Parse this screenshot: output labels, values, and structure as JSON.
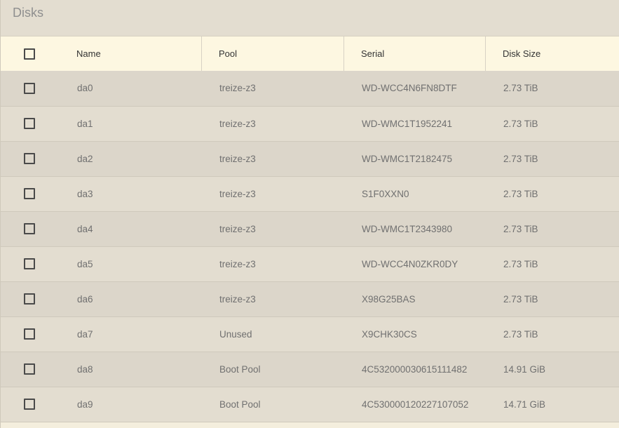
{
  "panel": {
    "title": "Disks"
  },
  "table": {
    "columns": [
      "Name",
      "Pool",
      "Serial",
      "Disk Size"
    ],
    "rows": [
      {
        "name": "da0",
        "pool": "treize-z3",
        "serial": "WD-WCC4N6FN8DTF",
        "size": "2.73 TiB"
      },
      {
        "name": "da1",
        "pool": "treize-z3",
        "serial": "WD-WMC1T1952241",
        "size": "2.73 TiB"
      },
      {
        "name": "da2",
        "pool": "treize-z3",
        "serial": "WD-WMC1T2182475",
        "size": "2.73 TiB"
      },
      {
        "name": "da3",
        "pool": "treize-z3",
        "serial": "S1F0XXN0",
        "size": "2.73 TiB"
      },
      {
        "name": "da4",
        "pool": "treize-z3",
        "serial": "WD-WMC1T2343980",
        "size": "2.73 TiB"
      },
      {
        "name": "da5",
        "pool": "treize-z3",
        "serial": "WD-WCC4N0ZKR0DY",
        "size": "2.73 TiB"
      },
      {
        "name": "da6",
        "pool": "treize-z3",
        "serial": "X98G25BAS",
        "size": "2.73 TiB"
      },
      {
        "name": "da7",
        "pool": "Unused",
        "serial": "X9CHK30CS",
        "size": "2.73 TiB"
      },
      {
        "name": "da8",
        "pool": "Boot Pool",
        "serial": "4C532000030615111482",
        "size": "14.91 GiB"
      },
      {
        "name": "da9",
        "pool": "Boot Pool",
        "serial": "4C530000120227107052",
        "size": "14.71 GiB"
      }
    ]
  },
  "colors": {
    "header_bg": "#fdf7e1",
    "row_odd_bg": "#dcd6ca",
    "row_even_bg": "#e3ddd0",
    "title_text": "#8f8f8f"
  }
}
